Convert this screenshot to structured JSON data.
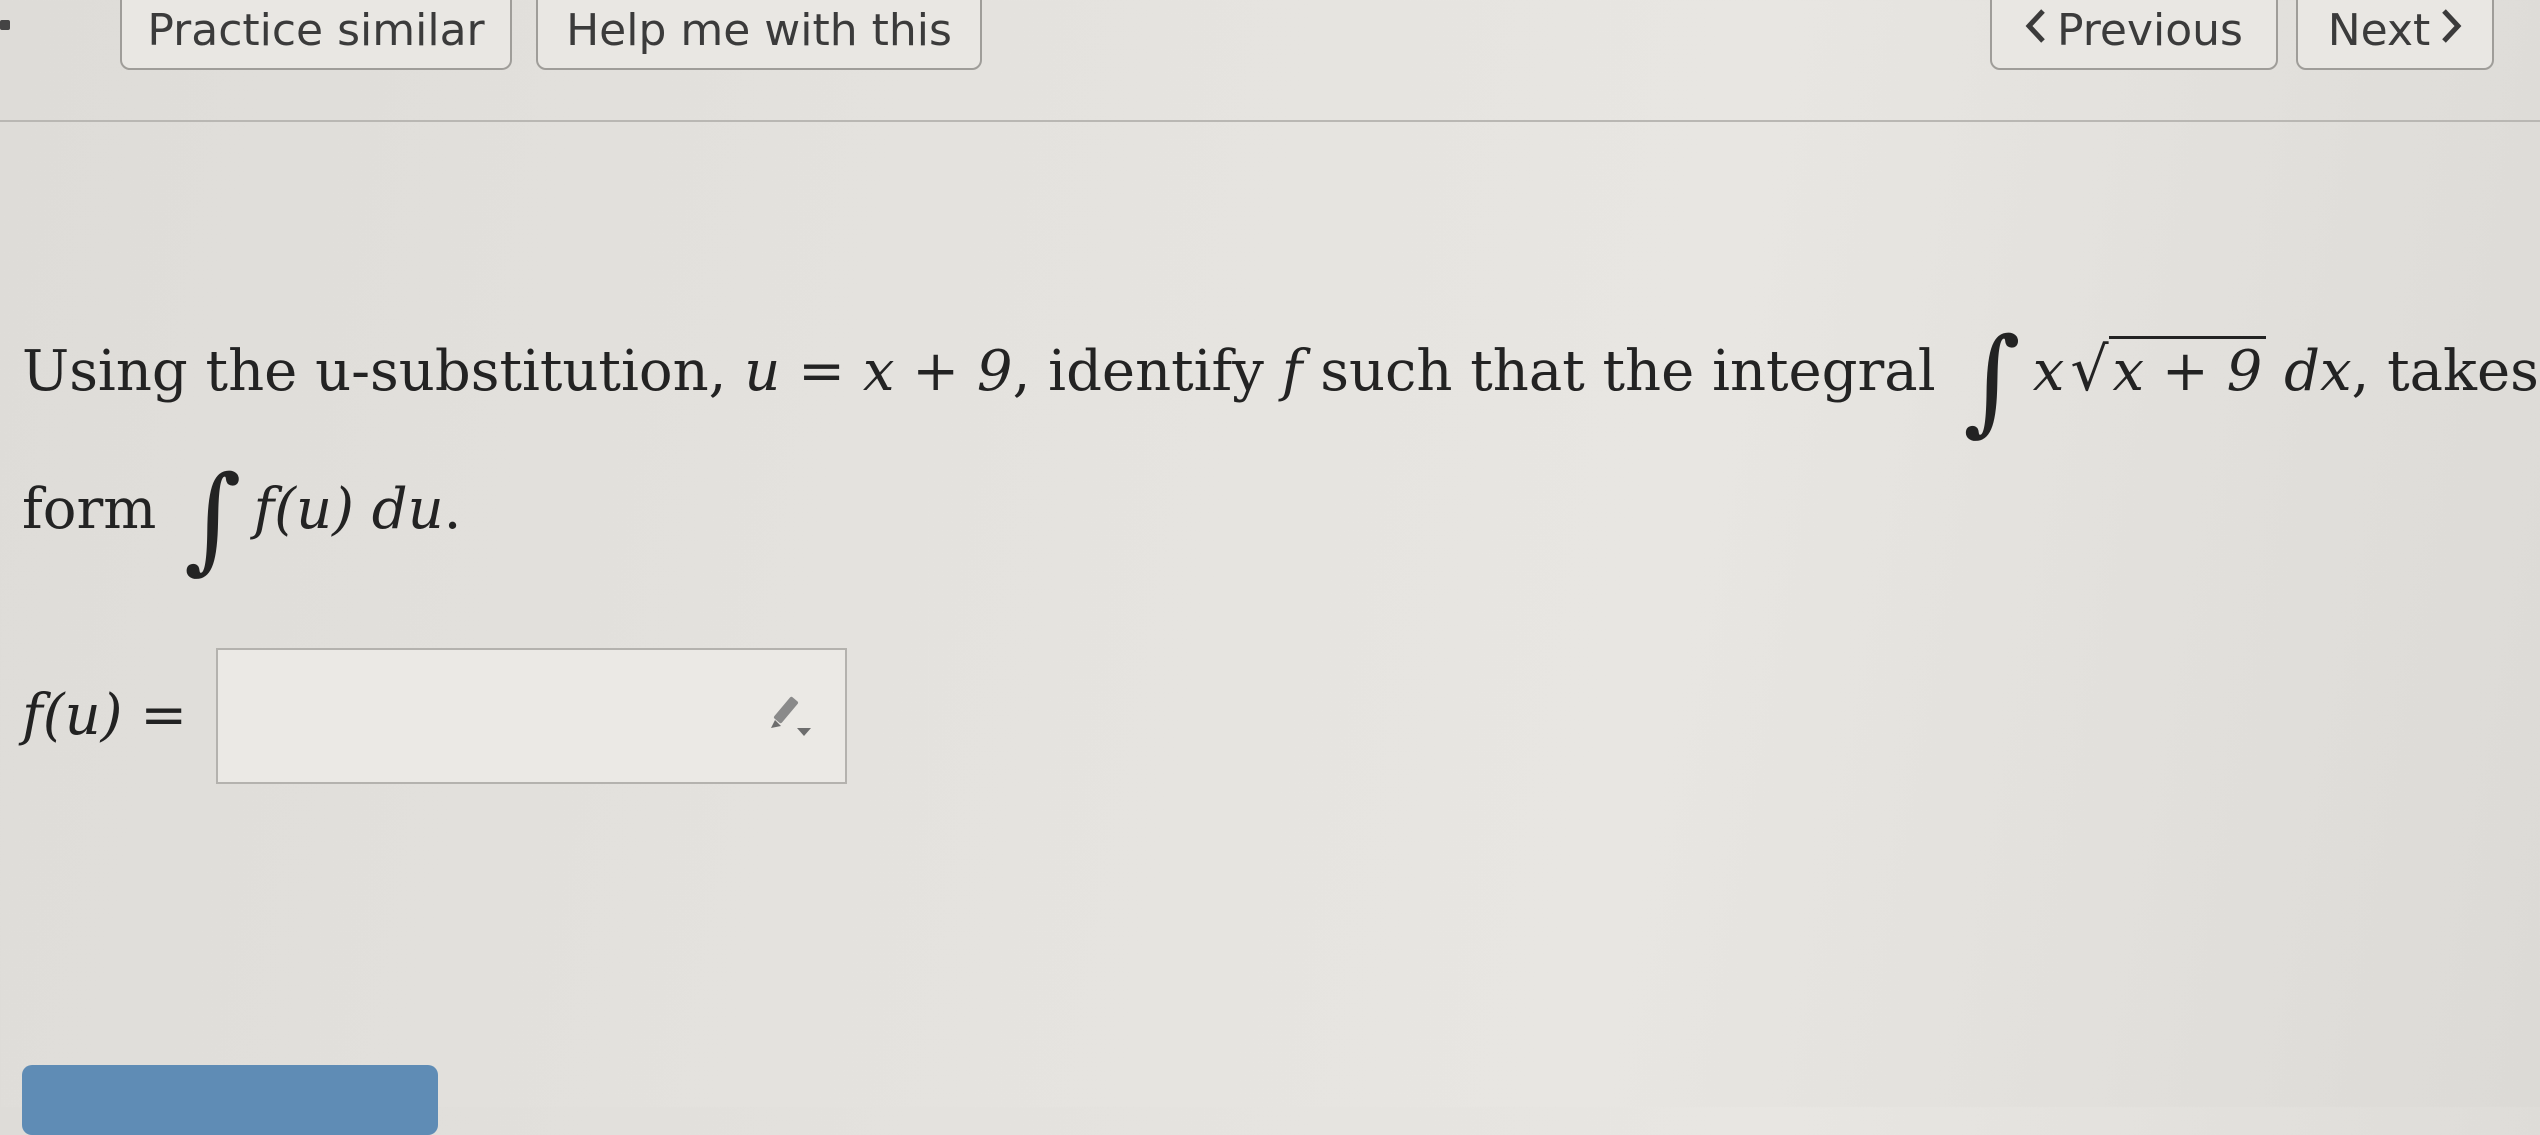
{
  "toolbar": {
    "practice_label": "Practice similar",
    "help_label": "Help me with this",
    "previous_label": "Previous",
    "next_label": "Next"
  },
  "question": {
    "part1": "Using the u-substitution, ",
    "sub_eq": "u = x + 9",
    "part2": ", identify ",
    "f": "f",
    "part3": " such that the integral ",
    "integrand_x": "x",
    "sqrt_symbol": "√",
    "radicand": "x + 9",
    "dx": "dx",
    "part4": ", takes the",
    "part5": "form ",
    "fu_du": "f(u) du",
    "period": "."
  },
  "answer": {
    "label": "f(u) =",
    "value": ""
  },
  "colors": {
    "background": "#e4e2de",
    "button_border": "#9f9d99",
    "submit_blue": "#5f8cb5"
  },
  "icons": {
    "previous": "chevron-left-icon",
    "next": "chevron-right-icon",
    "editor": "pencil-icon"
  }
}
